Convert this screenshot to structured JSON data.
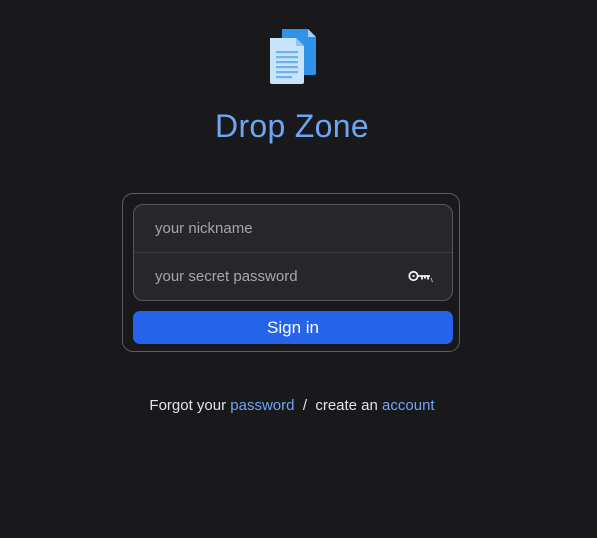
{
  "app": {
    "title": "Drop Zone",
    "logo_icon": "documents-icon"
  },
  "login": {
    "nickname_placeholder": "your nickname",
    "password_placeholder": "your secret password",
    "password_icon": "key-icon",
    "sign_in_label": "Sign in"
  },
  "footer": {
    "forgot_prefix": "Forgot your ",
    "password_link": "password",
    "separator": "  /  ",
    "create_prefix": "create an ",
    "account_link": "account"
  },
  "colors": {
    "background": "#19181b",
    "accent": "#6ea6f3",
    "button": "#2563eb",
    "field_background": "#27262a"
  }
}
